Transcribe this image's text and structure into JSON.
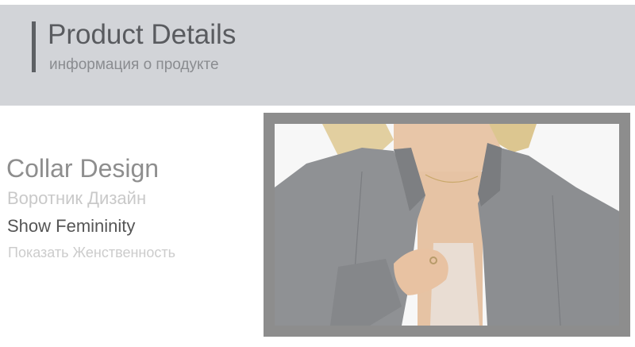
{
  "header": {
    "title": "Product Details",
    "subtitle": "информация о продукте"
  },
  "feature": {
    "title": "Collar Design",
    "title_ru": "Воротник Дизайн",
    "subtitle": "Show Femininity",
    "subtitle_ru": "Показать Женственность"
  },
  "colors": {
    "header_band": "#d2d4d8",
    "frame": "#8d8d8d",
    "jacket": "#8f9194"
  }
}
